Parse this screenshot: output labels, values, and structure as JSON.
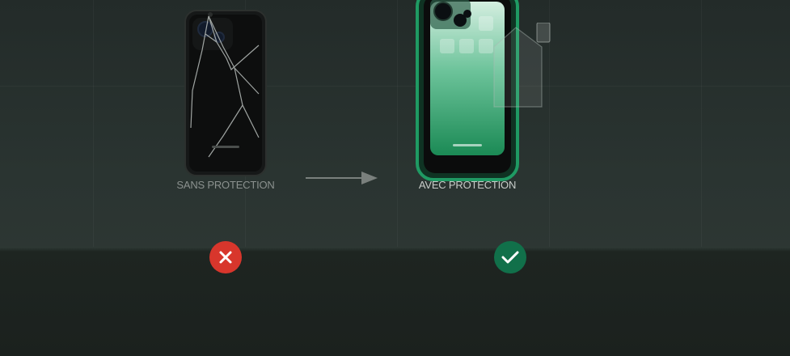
{
  "comparison": {
    "without": {
      "label": "SANS PROTECTION",
      "status_icon": "x-icon",
      "status_color": "#d8362c"
    },
    "with": {
      "label": "AVEC PROTECTION",
      "status_icon": "check-icon",
      "status_color": "#11704a"
    }
  },
  "colors": {
    "accent_green": "#1f9a63",
    "screen_green_top": "#d4eee0",
    "screen_green_bottom": "#1b8a55",
    "error_red": "#d8362c",
    "success_green": "#11704a"
  }
}
